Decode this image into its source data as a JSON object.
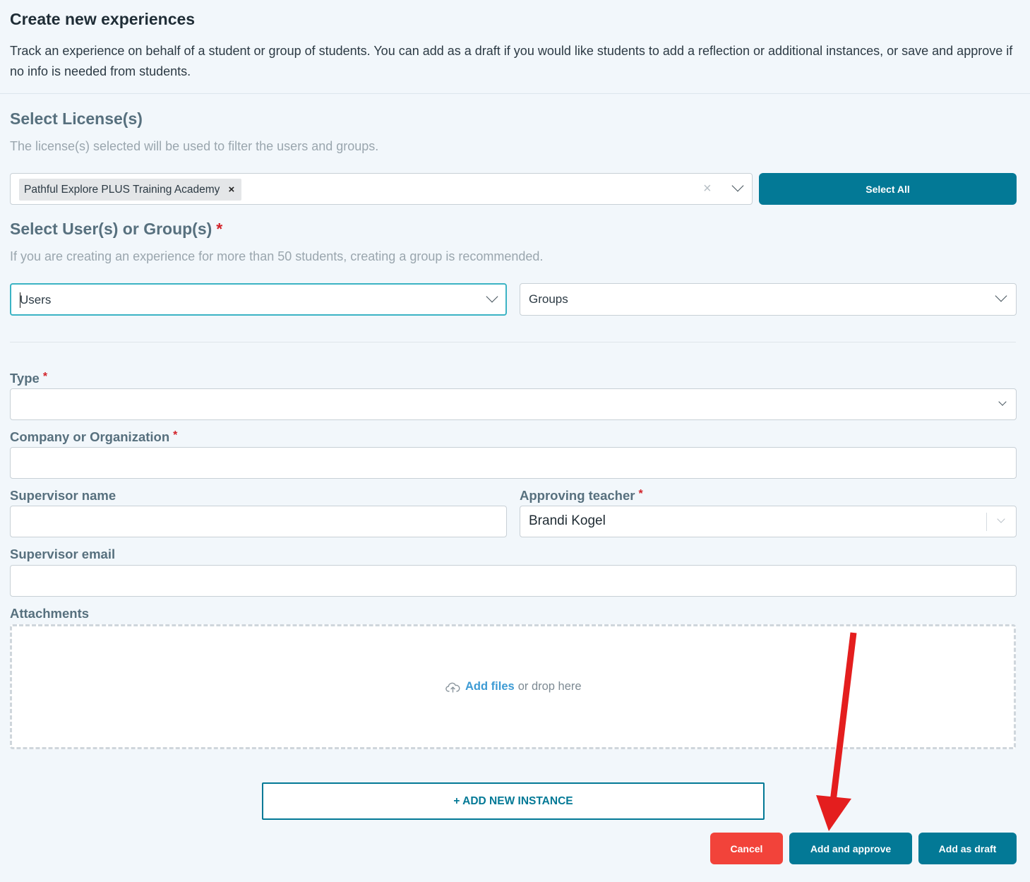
{
  "header": {
    "title": "Create new experiences",
    "description": "Track an experience on behalf of a student or group of students. You can add as a draft if you would like students to add a reflection or additional instances, or save and approve if no info is needed from students."
  },
  "licenses": {
    "title": "Select License(s)",
    "help": "The license(s) selected will be used to filter the users and groups.",
    "selected_tag": "Pathful Explore PLUS Training Academy",
    "tag_remove": "×",
    "clear": "×",
    "select_all_label": "Select All"
  },
  "users_groups": {
    "title": "Select User(s) or Group(s)",
    "required_mark": "*",
    "help": "If you are creating an experience for more than 50 students, creating a group is recommended.",
    "users_placeholder": "Users",
    "groups_placeholder": "Groups"
  },
  "form": {
    "type_label": "Type",
    "company_label": "Company or Organization",
    "supervisor_name_label": "Supervisor name",
    "approving_teacher_label": "Approving teacher",
    "approving_teacher_value": "Brandi Kogel",
    "supervisor_email_label": "Supervisor email",
    "attachments_label": "Attachments",
    "required_mark": "*"
  },
  "dropzone": {
    "link": "Add files",
    "text": "or drop here"
  },
  "actions": {
    "add_instance": "+ ADD NEW INSTANCE",
    "cancel": "Cancel",
    "add_and_approve": "Add and approve",
    "add_as_draft": "Add as draft"
  },
  "colors": {
    "primary": "#037996",
    "danger": "#f2433a",
    "annotation_arrow": "#e41e1e",
    "background": "#f2f7fb"
  }
}
